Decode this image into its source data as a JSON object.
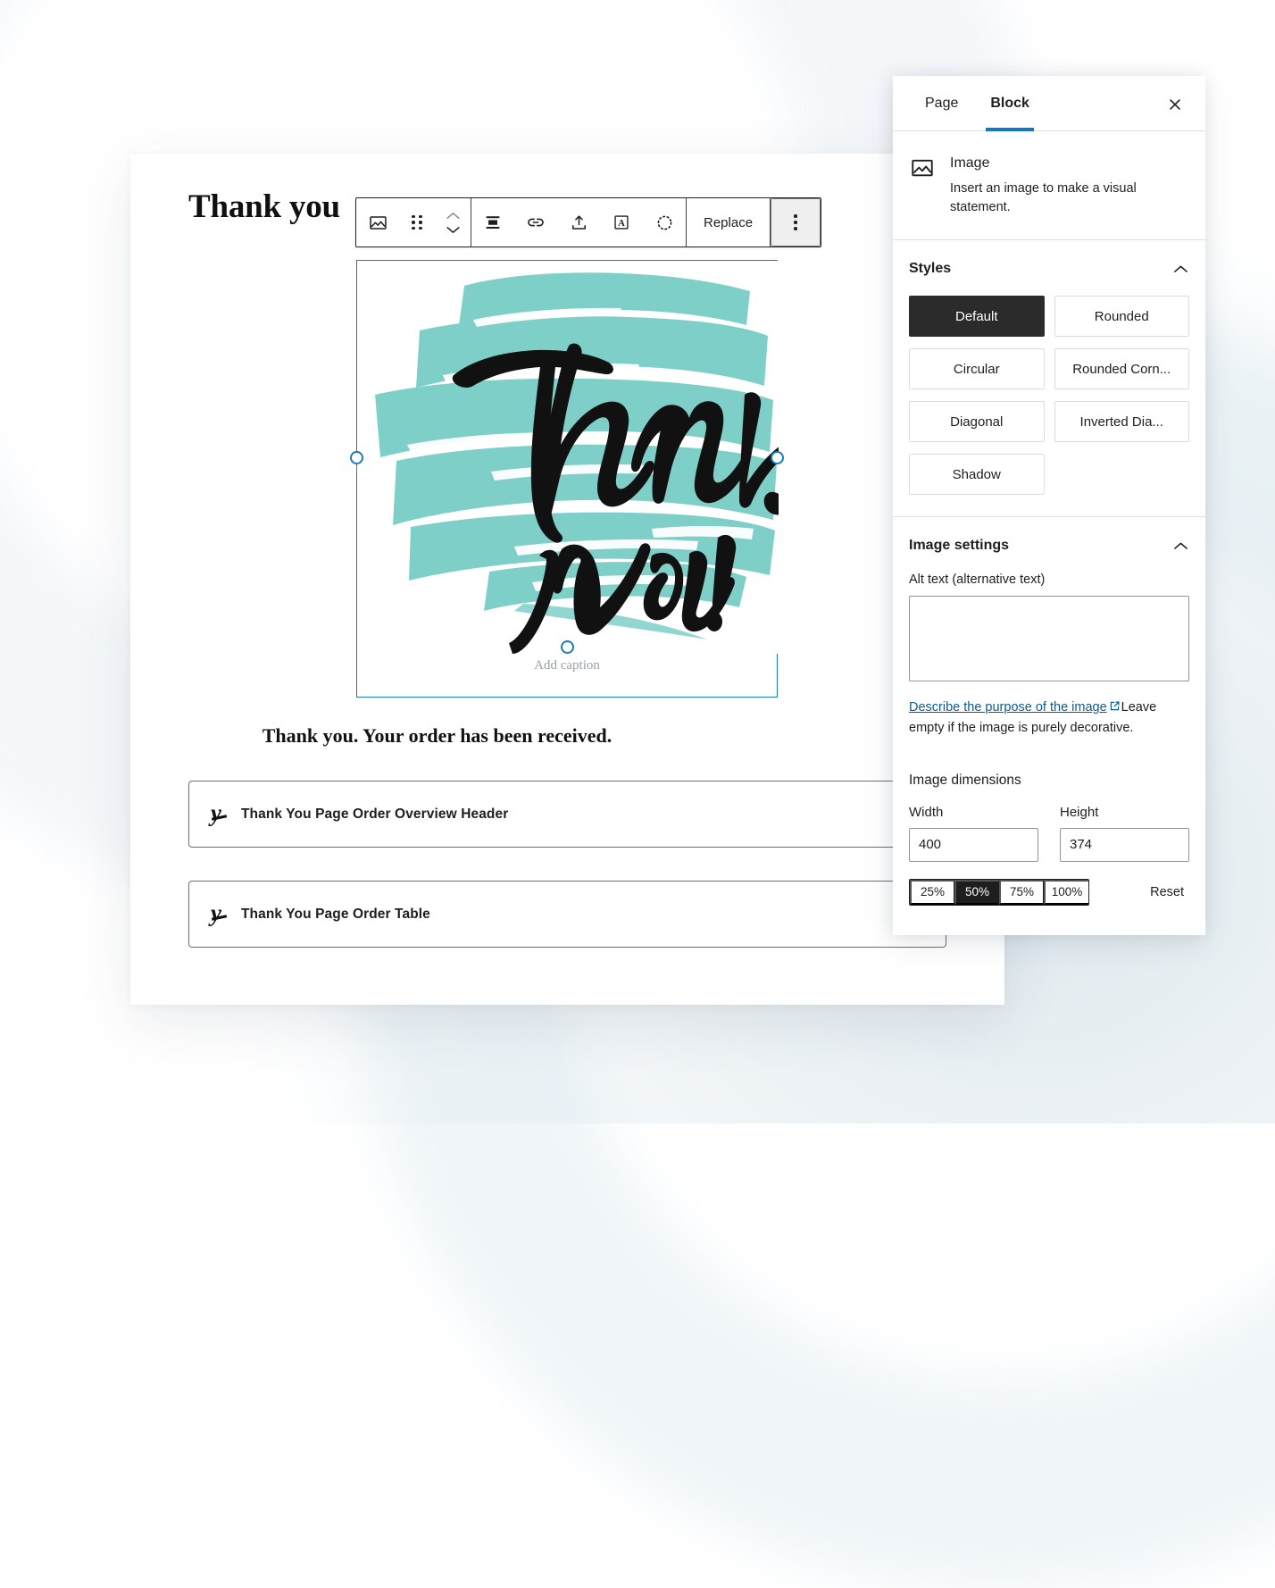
{
  "editor": {
    "page_title": "Thank you",
    "received_text": "Thank you. Your order has been received.",
    "caption_placeholder": "Add caption",
    "toolbar": {
      "image_icon": "image-icon",
      "drag_icon": "drag-handle-icon",
      "move_icon": "move-up-down-icon",
      "align_icon": "align-icon",
      "link_icon": "link-icon",
      "crop_icon": "upload-crop-icon",
      "textover_icon": "text-over-image-icon",
      "filter_icon": "duotone-filter-icon",
      "replace_label": "Replace",
      "more_icon": "more-options-icon"
    },
    "blocks": [
      {
        "logo": "yith-logo",
        "label": "Thank You Page Order Overview Header"
      },
      {
        "logo": "yith-logo",
        "label": "Thank You Page Order Table"
      }
    ],
    "artwork": {
      "line1": "Thank",
      "line2": "You!",
      "brush_color": "#7fcfc9",
      "ink_color": "#111111"
    }
  },
  "panel": {
    "tabs": [
      {
        "label": "Page",
        "active": false
      },
      {
        "label": "Block",
        "active": true
      }
    ],
    "close_icon": "close-icon",
    "accent_color": "#1279be",
    "block_card": {
      "icon": "image-icon",
      "title": "Image",
      "description": "Insert an image to make a visual statement."
    },
    "styles": {
      "title": "Styles",
      "collapse_icon": "chevron-up-icon",
      "options": [
        {
          "label": "Default",
          "selected": true
        },
        {
          "label": "Rounded",
          "selected": false
        },
        {
          "label": "Circular",
          "selected": false
        },
        {
          "label": "Rounded Corn...",
          "selected": false
        },
        {
          "label": "Diagonal",
          "selected": false
        },
        {
          "label": "Inverted Dia...",
          "selected": false
        },
        {
          "label": "Shadow",
          "selected": false
        }
      ]
    },
    "image_settings": {
      "title": "Image settings",
      "collapse_icon": "chevron-up-icon",
      "alt_label": "Alt text (alternative text)",
      "alt_value": "",
      "help_link": "Describe the purpose of the image",
      "help_link_icon": "external-link-icon",
      "help_rest": "Leave empty if the image is purely decorative.",
      "dimensions_title": "Image dimensions",
      "width_label": "Width",
      "width_value": "400",
      "height_label": "Height",
      "height_value": "374",
      "scales": [
        {
          "label": "25%",
          "selected": false
        },
        {
          "label": "50%",
          "selected": true
        },
        {
          "label": "75%",
          "selected": false
        },
        {
          "label": "100%",
          "selected": false
        }
      ],
      "reset_label": "Reset"
    }
  }
}
